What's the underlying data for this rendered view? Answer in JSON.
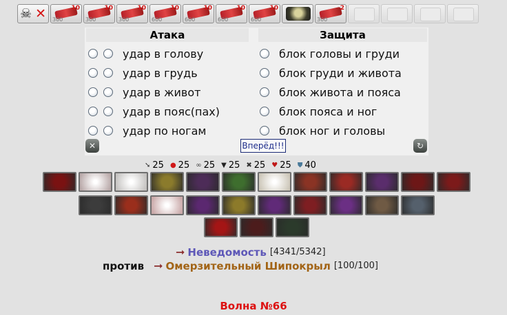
{
  "toolbar": {
    "scrolls": [
      {
        "type": "skull",
        "icon": "skull-cross-icon",
        "badge": "",
        "sub": ""
      },
      {
        "type": "red",
        "icon": "red-scroll-icon",
        "badge": "10",
        "sub": "300"
      },
      {
        "type": "red",
        "icon": "red-scroll-icon",
        "badge": "10",
        "sub": "300"
      },
      {
        "type": "red",
        "icon": "red-scroll-icon",
        "badge": "10",
        "sub": "300"
      },
      {
        "type": "red",
        "icon": "red-scroll-icon",
        "badge": "10",
        "sub": "600"
      },
      {
        "type": "red",
        "icon": "red-scroll-icon",
        "badge": "10",
        "sub": "600"
      },
      {
        "type": "red",
        "icon": "red-scroll-icon",
        "badge": "10",
        "sub": "600"
      },
      {
        "type": "red",
        "icon": "red-scroll-icon",
        "badge": "10",
        "sub": "600"
      },
      {
        "type": "dark",
        "icon": "dark-scroll-icon",
        "badge": "",
        "sub": ""
      },
      {
        "type": "red",
        "icon": "red-scroll-icon",
        "badge": "2",
        "sub": "300"
      },
      {
        "type": "empty",
        "icon": "empty-slot-icon",
        "badge": "",
        "sub": ""
      },
      {
        "type": "empty",
        "icon": "empty-slot-icon",
        "badge": "",
        "sub": ""
      },
      {
        "type": "empty",
        "icon": "empty-slot-icon",
        "badge": "",
        "sub": ""
      },
      {
        "type": "empty",
        "icon": "empty-slot-icon",
        "badge": "",
        "sub": ""
      }
    ]
  },
  "attack": {
    "title": "Атака",
    "items": [
      "удар в голову",
      "удар в грудь",
      "удар в живот",
      "удар в пояс(пах)",
      "удар по ногам"
    ]
  },
  "defense": {
    "title": "Защита",
    "items": [
      "блок головы и груди",
      "блок груди и живота",
      "блок живота и пояса",
      "блок пояса и ног",
      "блок ног и головы"
    ]
  },
  "go_label": "Вперёд!!!",
  "stats": [
    {
      "icon": "sword-icon",
      "value": "25"
    },
    {
      "icon": "blood-drop-icon",
      "value": "25"
    },
    {
      "icon": "chain-icon",
      "value": "25"
    },
    {
      "icon": "armor-icon",
      "value": "25"
    },
    {
      "icon": "crossed-swords-icon",
      "value": "25"
    },
    {
      "icon": "heart-icon",
      "value": "25"
    },
    {
      "icon": "shield-icon",
      "value": "40"
    }
  ],
  "skills": {
    "row1": [
      {
        "icon": "blood-skill-icon",
        "color": "#7a1212"
      },
      {
        "icon": "faded-skill-icon",
        "color": "#b9a9a9"
      },
      {
        "icon": "faded-skill-icon",
        "color": "#c4c2c0"
      },
      {
        "icon": "golden-armor-skill-icon",
        "color": "#8b7b2c"
      },
      {
        "icon": "cross-skill-icon",
        "color": "#4d2c58"
      },
      {
        "icon": "green-shield-skill-icon",
        "color": "#3e6e2e"
      },
      {
        "icon": "faded-skill-icon",
        "color": "#ccc6b8"
      },
      {
        "icon": "sword-skill-icon",
        "color": "#8a3324"
      },
      {
        "icon": "blade-skill-icon",
        "color": "#9a2a24"
      },
      {
        "icon": "axe-skill-icon",
        "color": "#5a2d6c"
      },
      {
        "icon": "helmet-skill-icon",
        "color": "#6d1717"
      },
      {
        "icon": "red-rune-skill-icon",
        "color": "#7c1a1a"
      }
    ],
    "row2": [
      {
        "icon": "crossed-axes-skill-icon",
        "color": "#3c3c3c"
      },
      {
        "icon": "fire-blade-skill-icon",
        "color": "#9a2e1c"
      },
      {
        "icon": "faded-skill-icon",
        "color": "#c9a8a8"
      },
      {
        "icon": "purple-claw-skill-icon",
        "color": "#5b2870"
      },
      {
        "icon": "golden-skill-icon",
        "color": "#8c7a2a"
      },
      {
        "icon": "purple-blades-skill-icon",
        "color": "#602a78"
      },
      {
        "icon": "red-spear-skill-icon",
        "color": "#7e1e22"
      },
      {
        "icon": "purple-orb-skill-icon",
        "color": "#6b2f84"
      },
      {
        "icon": "warrior-skill-icon",
        "color": "#6f5a44"
      },
      {
        "icon": "wings-skill-icon",
        "color": "#55606c"
      }
    ],
    "row3": [
      {
        "icon": "red-flash-skill-icon",
        "color": "#a41515"
      },
      {
        "icon": "strike-skill-icon",
        "color": "#4c1c1c"
      },
      {
        "icon": "green-leaf-skill-icon",
        "color": "#2b3a2b"
      }
    ]
  },
  "battle": {
    "hero_name": "Неведомость",
    "hero_hp": "[4341/5342]",
    "vs_label": "против",
    "mob_name": "Омерзительный Шипокрыл",
    "mob_hp": "[100/100]",
    "wave": "Волна №66"
  }
}
